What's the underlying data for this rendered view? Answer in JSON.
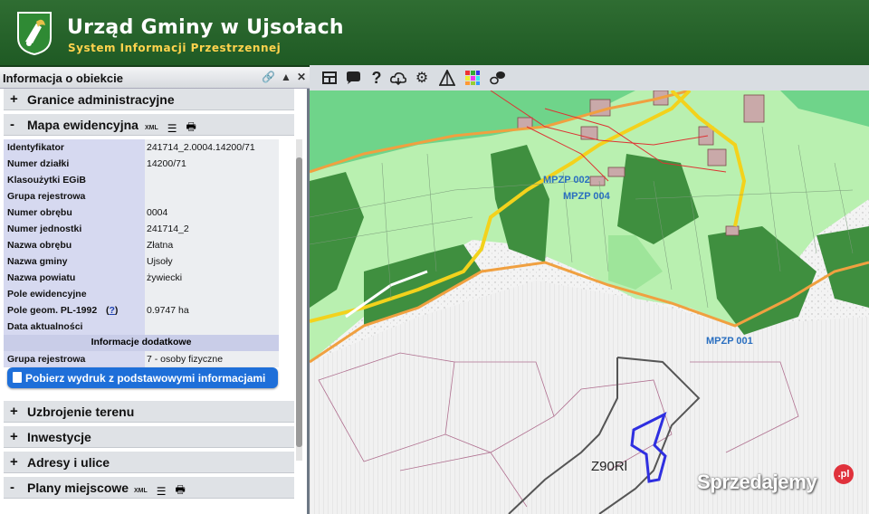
{
  "header": {
    "title": "Urząd Gminy w Ujsołach",
    "subtitle": "System Informacji Przestrzennej"
  },
  "toolbar": {
    "icons": [
      "layout-icon",
      "speech-bubble-icon",
      "help-icon",
      "cloud-icon",
      "settings-icon",
      "measure-icon",
      "color-grid-icon",
      "share-icon"
    ]
  },
  "panel": {
    "title": "Informacja o obiekcie",
    "sections": {
      "granice": {
        "sign": "+",
        "label": "Granice administracyjne"
      },
      "mapa": {
        "sign": "-",
        "label": "Mapa ewidencyjna",
        "xml": "XML"
      },
      "uzbrojenie": {
        "sign": "+",
        "label": "Uzbrojenie terenu"
      },
      "inwestycje": {
        "sign": "+",
        "label": "Inwestycje"
      },
      "adresy": {
        "sign": "+",
        "label": "Adresy i ulice"
      },
      "plany": {
        "sign": "-",
        "label": "Plany miejscowe",
        "xml": "XML"
      }
    },
    "attributes": [
      {
        "key": "Identyfikator",
        "value": "241714_2.0004.14200/71"
      },
      {
        "key": "Numer działki",
        "value": "14200/71"
      },
      {
        "key": "Klasoużytki EGiB",
        "value": ""
      },
      {
        "key": "Grupa rejestrowa",
        "value": ""
      },
      {
        "key": "Numer obrębu",
        "value": "0004"
      },
      {
        "key": "Numer jednostki",
        "value": "241714_2"
      },
      {
        "key": "Nazwa obrębu",
        "value": "Złatna"
      },
      {
        "key": "Nazwa gminy",
        "value": "Ujsoły"
      },
      {
        "key": "Nazwa powiatu",
        "value": "żywiecki"
      },
      {
        "key": "Pole ewidencyjne",
        "value": ""
      },
      {
        "key": "Pole geom. PL-1992",
        "value": "0.9747 ha",
        "link": "?"
      },
      {
        "key": "Data aktualności",
        "value": ""
      }
    ],
    "extra_header": "Informacje dodatkowe",
    "extra": [
      {
        "key": "Grupa rejestrowa",
        "value": "7 - osoby fizyczne"
      }
    ],
    "download_label": "Pobierz wydruk z podstawowymi informacjami"
  },
  "map": {
    "labels": {
      "mpzp002": "MPZP 002",
      "mpzp004": "MPZP 004",
      "mpzp001": "MPZP 001",
      "zone": "Z90Rl"
    },
    "colors": {
      "forest_dark": "#3f8f3f",
      "meadow": "#9ee59a",
      "light_green": "#b9f0b0",
      "orange_border": "#f0a040",
      "road_yellow": "#f3d21c",
      "parcel_outline": "#2f2fe0"
    }
  },
  "watermark": {
    "text": "Sprzedajemy",
    "badge": ".pl"
  }
}
